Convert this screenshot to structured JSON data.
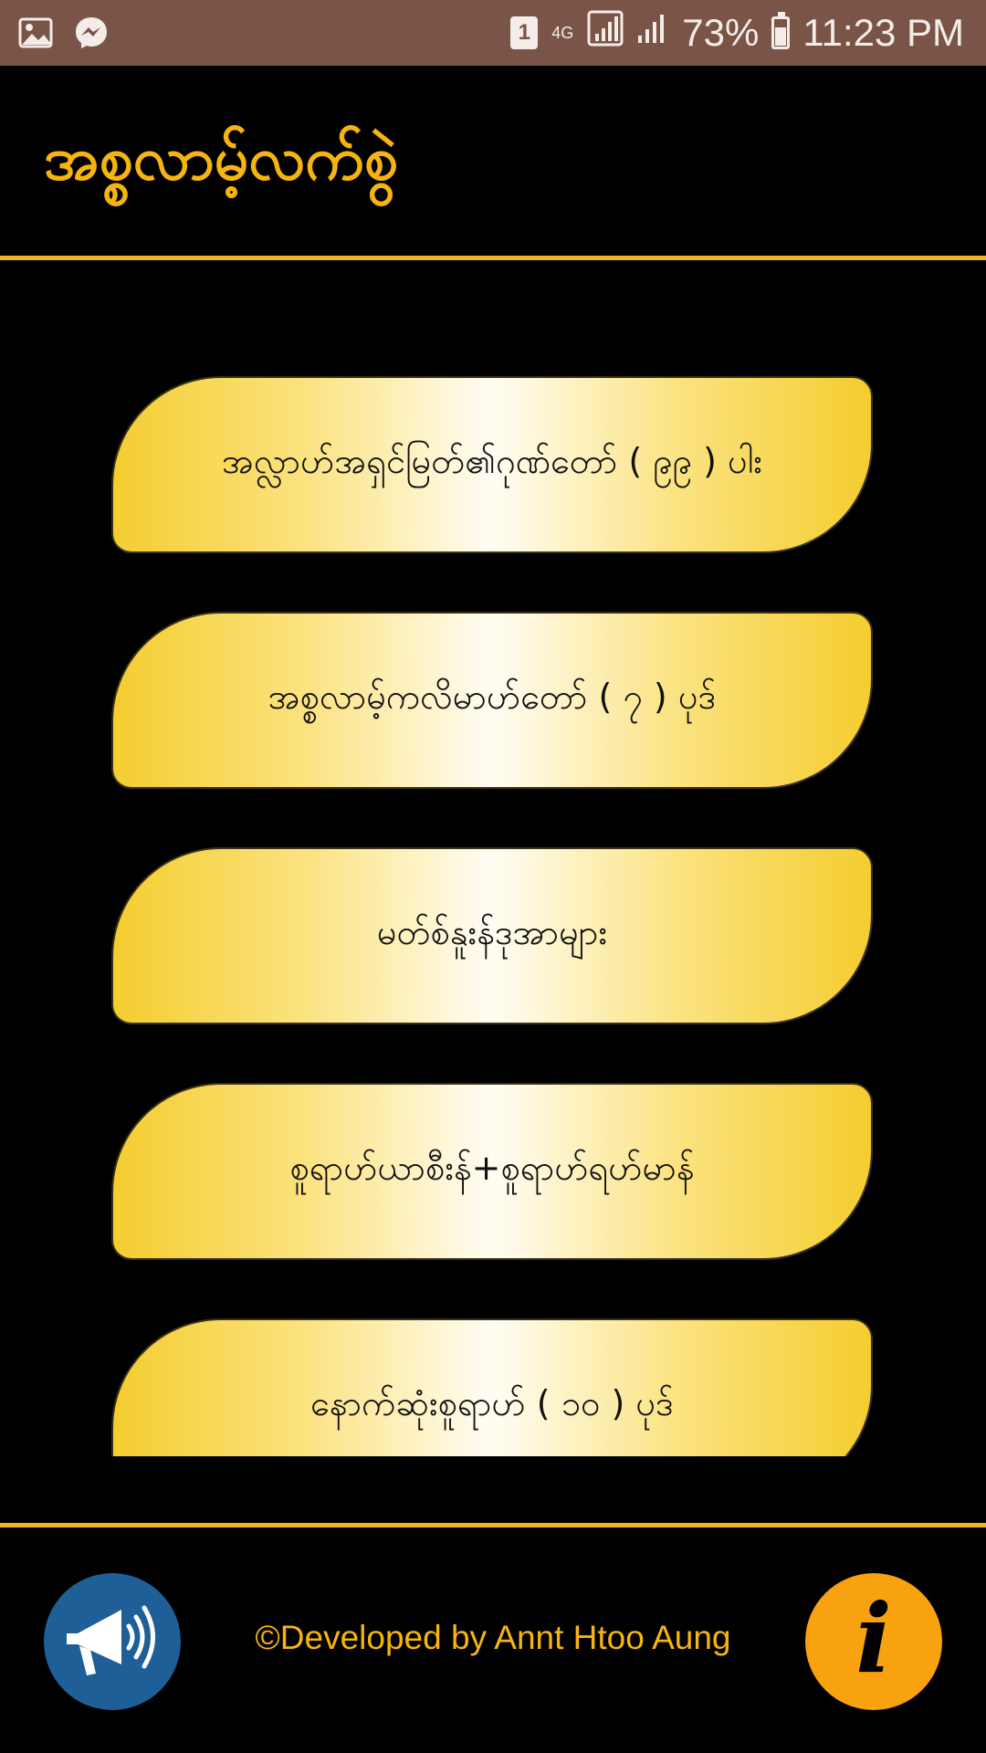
{
  "status_bar": {
    "icons_left": [
      "image-icon",
      "messenger-icon"
    ],
    "notification_count": "1",
    "network": "4G",
    "battery": "73%",
    "battery_level": 0.73,
    "time": "11:23 PM"
  },
  "header": {
    "title": "အစ္စလာမ့်လက်စွဲ"
  },
  "menu": {
    "items": [
      {
        "label": "အလ္လာဟ်အရှင်မြတ်၏ဂုဏ်တော် ( ၉၉ ) ပါး"
      },
      {
        "label": "အစ္စလာမ့်ကလိမာဟ်တော် ( ၇ ) ပုဒ်"
      },
      {
        "label": "မတ်စ်နူးန်ဒုအာများ"
      },
      {
        "label": "စူရာဟ်ယာစီးန်+စူရာဟ်ရဟ်မာန်"
      },
      {
        "label": "နောက်ဆုံးစူရာဟ် ( ၁၀ ) ပုဒ်"
      }
    ]
  },
  "footer": {
    "credit": "©Developed by Annt Htoo Aung",
    "announce_icon": "megaphone-icon",
    "info_icon": "info-icon"
  },
  "colors": {
    "accent": "#f6b50e",
    "status_bar": "#7a5446",
    "announce_bg": "#1e5f98",
    "info_bg": "#f7a20e"
  }
}
